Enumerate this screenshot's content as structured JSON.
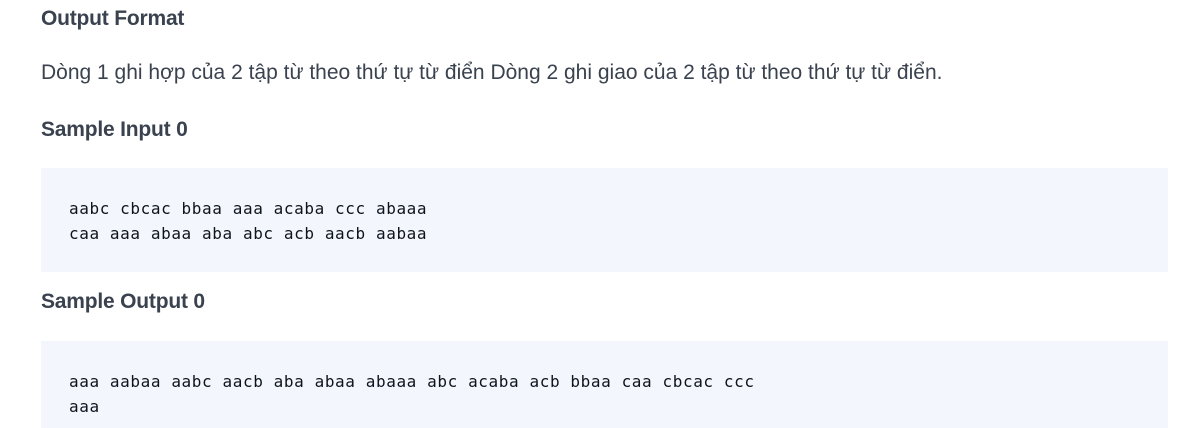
{
  "output_format": {
    "heading": "Output Format",
    "text": "Dòng 1 ghi hợp của 2 tập từ theo thứ tự từ điển Dòng 2 ghi giao của 2 tập từ theo thứ tự từ điển."
  },
  "sample_input": {
    "heading": "Sample Input 0",
    "lines": [
      "aabc cbcac bbaa aaa acaba ccc abaaa",
      "caa aaa abaa aba abc acb aacb aabaa"
    ]
  },
  "sample_output": {
    "heading": "Sample Output 0",
    "lines": [
      "aaa aabaa aabc aacb aba abaa abaaa abc acaba acb bbaa caa cbcac ccc",
      "aaa"
    ]
  }
}
